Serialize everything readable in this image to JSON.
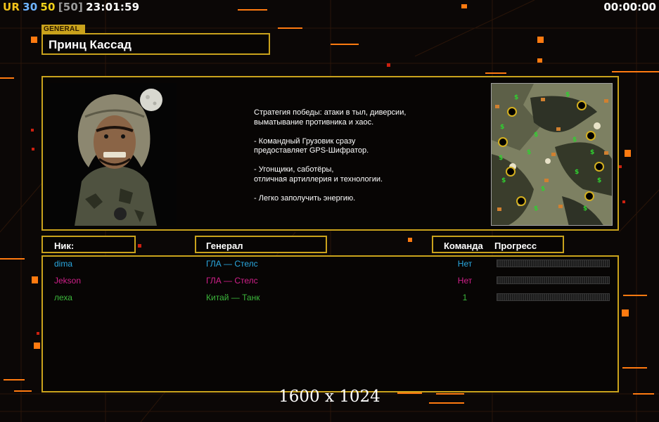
{
  "hud": {
    "prefix": "UR",
    "value_a": "30",
    "value_b": "50",
    "value_c": "[50]",
    "time": "23:01:59",
    "timer": "00:00:00",
    "colors": {
      "prefix": "#f2c21a",
      "value_a": "#6fb4ff",
      "value_b": "#f2d21a",
      "value_c": "#9a9a9a"
    }
  },
  "general": {
    "tag": "GENERAL",
    "name": "Принц Кассад",
    "portrait_icon": "soldier-portrait-icon",
    "strategy_text": "Стратегия победы: атаки в тыл, диверсии,\n выматывание противника и хаос.\n\n- Командный Грузовик сразу\nпредоставляет GPS-Шифратор.\n\n- Угонщики, саботёры,\nотличная артиллерия и технологии.\n\n- Легко заполучить энергию.",
    "map_icon": "minimap-icon"
  },
  "table": {
    "headers": {
      "nick": "Ник:",
      "general": "Генерал",
      "team": "Команда",
      "progress": "Прогресс"
    },
    "rows": [
      {
        "nick": "dima",
        "general": "ГЛА — Стелс",
        "team": "Нет",
        "progress": 0,
        "color": "#2aa8e0",
        "general_color": "#2aa8e0"
      },
      {
        "nick": "Jekson",
        "general": "ГЛА — Стелс",
        "team": "Нет",
        "progress": 0,
        "color": "#d0208a",
        "general_color": "#d0208a"
      },
      {
        "nick": "леха",
        "general": "Китай — Танк",
        "team": "1",
        "progress": 0,
        "color": "#3cb83c",
        "general_color": "#3cb83c"
      }
    ]
  },
  "resolution": "1600 x 1024",
  "theme": {
    "border": "#c9a21c",
    "accent": "#ff7a10"
  }
}
